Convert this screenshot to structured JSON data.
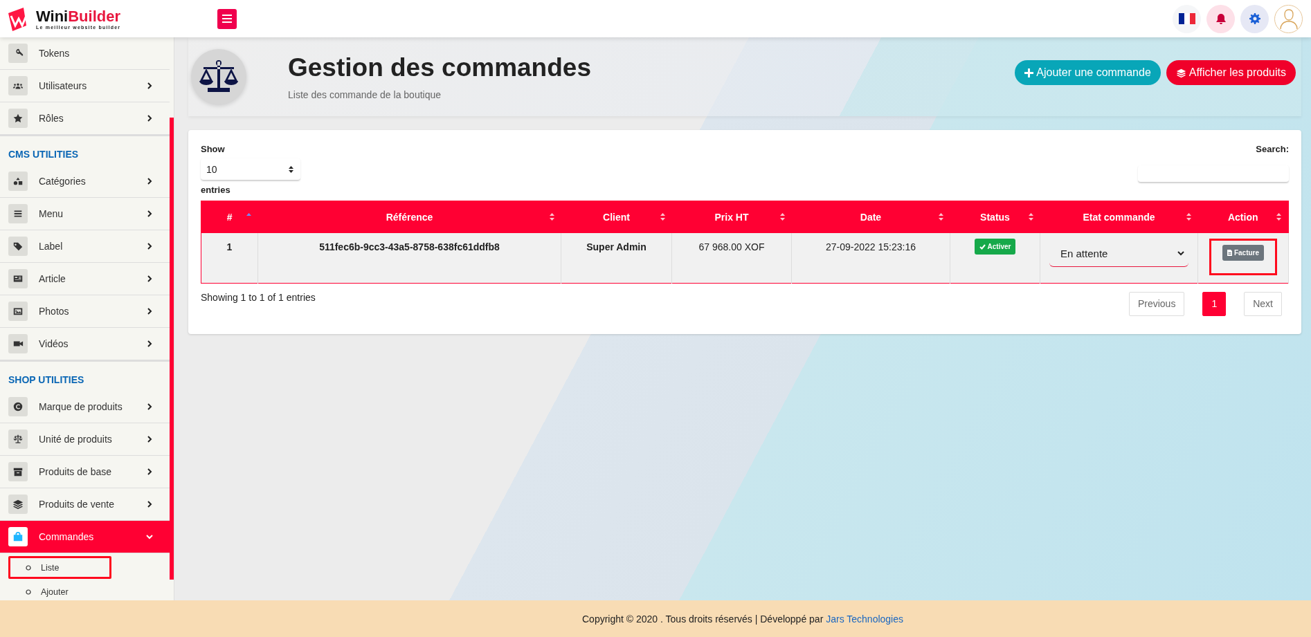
{
  "brand": {
    "name_part_1": "Wini",
    "name_part_2": "Builder",
    "tagline": "Le meilleur website builder"
  },
  "sidebar": {
    "sections": [
      {
        "items": [
          {
            "label": "Tokens",
            "has_submenu": false,
            "selected": false
          },
          {
            "label": "Utilisateurs",
            "has_submenu": true,
            "expanded": false,
            "selected": false
          },
          {
            "label": "Rôles",
            "has_submenu": true,
            "expanded": false,
            "selected": false
          }
        ]
      },
      {
        "heading": "CMS UTILITIES",
        "items": [
          {
            "label": "Catégories",
            "has_submenu": true,
            "expanded": false,
            "selected": false
          },
          {
            "label": "Menu",
            "has_submenu": true,
            "expanded": false,
            "selected": false
          },
          {
            "label": "Label",
            "has_submenu": true,
            "expanded": false,
            "selected": false
          },
          {
            "label": "Article",
            "has_submenu": true,
            "expanded": false,
            "selected": false
          },
          {
            "label": "Photos",
            "has_submenu": true,
            "expanded": false,
            "selected": false
          },
          {
            "label": "Vidéos",
            "has_submenu": true,
            "expanded": false,
            "selected": false
          }
        ]
      },
      {
        "heading": "SHOP UTILITIES",
        "items": [
          {
            "label": "Marque de produits",
            "has_submenu": true,
            "expanded": false,
            "selected": false
          },
          {
            "label": "Unité de produits",
            "has_submenu": true,
            "expanded": false,
            "selected": false
          },
          {
            "label": "Produits de base",
            "has_submenu": true,
            "expanded": false,
            "selected": false
          },
          {
            "label": "Produits de vente",
            "has_submenu": true,
            "expanded": false,
            "selected": false
          },
          {
            "label": "Commandes",
            "has_submenu": true,
            "expanded": true,
            "selected": true,
            "children": [
              {
                "label": "Liste",
                "highlighted": true
              },
              {
                "label": "Ajouter",
                "highlighted": false
              }
            ]
          }
        ]
      }
    ]
  },
  "page_header": {
    "title": "Gestion des commandes",
    "subtitle": "Liste des commande de la boutique",
    "buttons": [
      {
        "label": "Ajouter une commande",
        "kind": "add"
      },
      {
        "label": "Afficher les produits",
        "kind": "products"
      }
    ]
  },
  "table_controls": {
    "show_label": "Show",
    "page_size": "10",
    "entries_label": "entries",
    "search_label": "Search:"
  },
  "table": {
    "columns": [
      {
        "label": "#",
        "sorted": true
      },
      {
        "label": "Référence",
        "sorted": false
      },
      {
        "label": "Client",
        "sorted": false
      },
      {
        "label": "Prix HT",
        "sorted": false
      },
      {
        "label": "Date",
        "sorted": false
      },
      {
        "label": "Status",
        "sorted": false
      },
      {
        "label": "Etat commande",
        "sorted": false
      },
      {
        "label": "Action",
        "sorted": false
      }
    ],
    "rows": [
      {
        "number": "1",
        "reference": "511fec6b-9cc3-43a5-8758-638fc61ddfb8",
        "client": "Super Admin",
        "price": "67 968.00 XOF",
        "date": "27-09-2022 15:23:16",
        "status": "Activer",
        "state": "En attente",
        "action": "Facture",
        "action_highlighted": true
      }
    ]
  },
  "table_footer": {
    "info": "Showing 1 to 1 of 1 entries",
    "pagination": [
      {
        "label": "Previous",
        "selected": false
      },
      {
        "label": "1",
        "selected": true
      },
      {
        "label": "Next",
        "selected": false
      }
    ]
  },
  "footer": {
    "text": "Copyright © 2020 . Tous droits réservés | Développé par ",
    "link": "Jars Technologies"
  }
}
